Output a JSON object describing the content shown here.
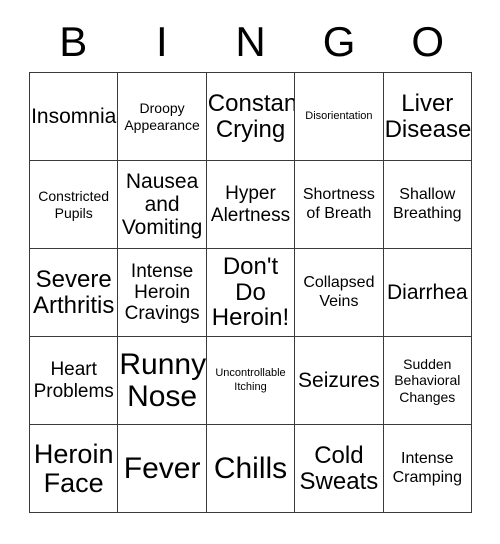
{
  "card": {
    "header_letters": [
      "B",
      "I",
      "N",
      "G",
      "O"
    ],
    "rows": [
      [
        {
          "text": "Insomnia",
          "size": "xl"
        },
        {
          "text": "Droopy\nAppearance",
          "size": "sm"
        },
        {
          "text": "Constant\nCrying",
          "size": "2xl"
        },
        {
          "text": "Disorientation",
          "size": "xs"
        },
        {
          "text": "Liver\nDisease",
          "size": "2xl"
        }
      ],
      [
        {
          "text": "Constricted\nPupils",
          "size": "sm"
        },
        {
          "text": "Nausea\nand\nVomiting",
          "size": "xl"
        },
        {
          "text": "Hyper\nAlertness",
          "size": "lg"
        },
        {
          "text": "Shortness\nof Breath",
          "size": "md"
        },
        {
          "text": "Shallow\nBreathing",
          "size": "md"
        }
      ],
      [
        {
          "text": "Severe\nArthritis",
          "size": "2xl"
        },
        {
          "text": "Intense\nHeroin\nCravings",
          "size": "lg"
        },
        {
          "text": "Don't\nDo\nHeroin!",
          "size": "2xl"
        },
        {
          "text": "Collapsed\nVeins",
          "size": "md"
        },
        {
          "text": "Diarrhea",
          "size": "xl"
        }
      ],
      [
        {
          "text": "Heart\nProblems",
          "size": "lg"
        },
        {
          "text": "Runny\nNose",
          "size": "4xl"
        },
        {
          "text": "Uncontrollable\nItching",
          "size": "xs"
        },
        {
          "text": "Seizures",
          "size": "xl"
        },
        {
          "text": "Sudden\nBehavioral\nChanges",
          "size": "sm"
        }
      ],
      [
        {
          "text": "Heroin\nFace",
          "size": "3xl"
        },
        {
          "text": "Fever",
          "size": "4xl"
        },
        {
          "text": "Chills",
          "size": "4xl"
        },
        {
          "text": "Cold\nSweats",
          "size": "2xl"
        },
        {
          "text": "Intense\nCramping",
          "size": "md"
        }
      ]
    ]
  },
  "colors": {
    "border": "#3a3a3a",
    "text": "#000000",
    "background": "#ffffff"
  }
}
